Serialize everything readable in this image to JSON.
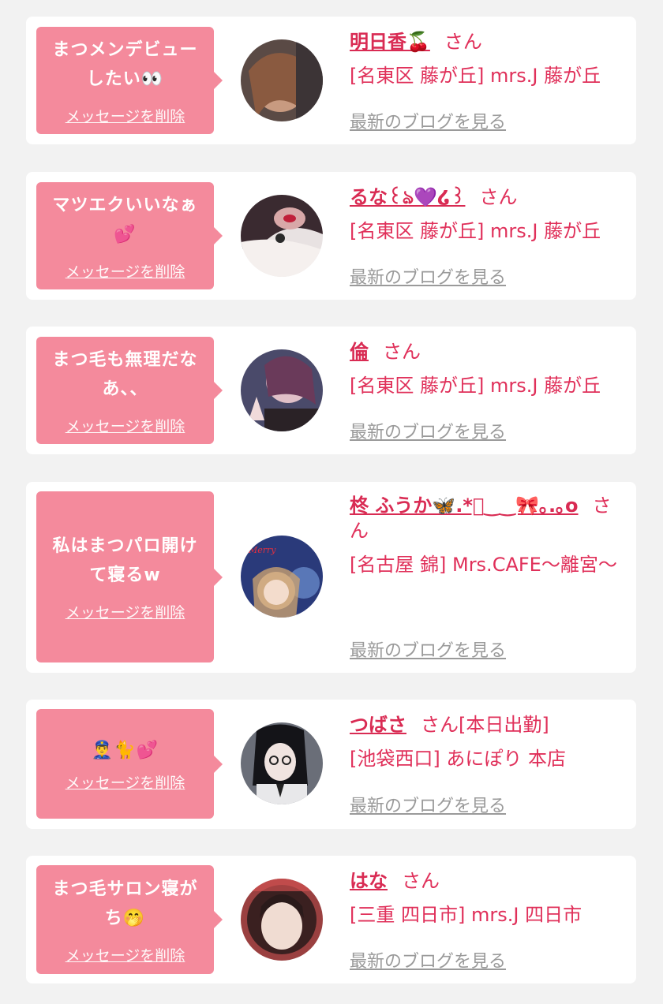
{
  "colors": {
    "background": "#f2f2f2",
    "card": "#ffffff",
    "bubble": "#f48a9c",
    "accent": "#e0305a",
    "link_gray": "#9a9a9a"
  },
  "delete_label": "メッセージを削除",
  "blog_label": "最新のブログを見る",
  "honorific": "さん",
  "entries": [
    {
      "message": "まつメンデビューしたい👀",
      "name": "明日香🍒",
      "extra": "",
      "shop": "[名東区 藤が丘] mrs.J 藤が丘",
      "avatar_icon": "user-photo"
    },
    {
      "message": "マツエクいいなぁ💕",
      "name": "るな꒰ঌ💜໒꒱",
      "extra": "",
      "shop": "[名東区 藤が丘] mrs.J 藤が丘",
      "avatar_icon": "user-photo"
    },
    {
      "message": "まつ毛も無理だなあ、、",
      "name": "倫",
      "extra": "",
      "shop": "[名東区 藤が丘] mrs.J 藤が丘",
      "avatar_icon": "user-photo"
    },
    {
      "message": "私はまつパロ開けて寝るw",
      "name": "柊 ふうか🦋.*ﾟ‿‿🎀｡.｡o",
      "extra": "",
      "shop": "[名古屋 錦] Mrs.CAFE〜離宮〜",
      "avatar_icon": "user-photo"
    },
    {
      "message": "👮‍♂️🐈💕",
      "name": "つばさ",
      "extra": "[本日出勤]",
      "shop": "[池袋西口] あにぽり 本店",
      "avatar_icon": "user-photo"
    },
    {
      "message": "まつ毛サロン寝がち🤭",
      "name": "はな",
      "extra": "",
      "shop": "[三重 四日市] mrs.J 四日市",
      "avatar_icon": "user-photo"
    }
  ]
}
